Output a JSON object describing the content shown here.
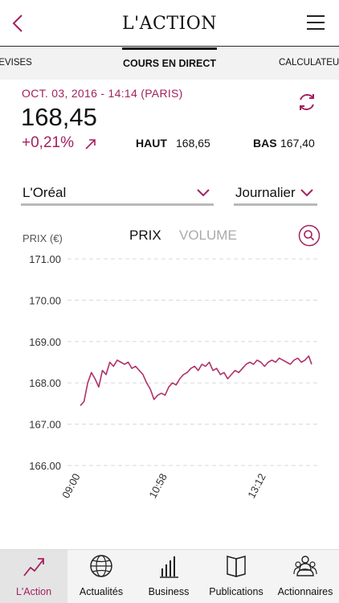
{
  "header": {
    "title": "L'ACTION"
  },
  "tabs": [
    {
      "label": "DEVISES"
    },
    {
      "label": "COURS EN DIRECT"
    },
    {
      "label": "CALCULATEUR"
    }
  ],
  "quote": {
    "date": "OCT. 03, 2016 - 14:14 (PARIS)",
    "price": "168,45",
    "change": "+0,21%",
    "high_label": "HAUT",
    "high_value": "168,65",
    "low_label": "BAS",
    "low_value": "167,40"
  },
  "selectors": {
    "company": "L'Oréal",
    "period": "Journalier"
  },
  "chart_controls": {
    "unit_label": "PRIX (€)",
    "tab_price": "PRIX",
    "tab_volume": "VOLUME"
  },
  "colors": {
    "accent": "#a3215f",
    "line": "#b0306a",
    "grid": "#d8d8d8"
  },
  "chart_data": {
    "type": "line",
    "title": "",
    "ylabel": "PRIX (€)",
    "ylim": [
      166.0,
      171.0
    ],
    "yticks": [
      "171.00",
      "170.00",
      "169.00",
      "168.00",
      "167.00",
      "166.00"
    ],
    "xticks": [
      "09:00",
      "10:58",
      "13:12"
    ],
    "grid": true,
    "series": [
      {
        "x": [
          "09:00",
          "09:05",
          "09:10",
          "09:15",
          "09:20",
          "09:25",
          "09:30",
          "09:35",
          "09:40",
          "09:45",
          "09:50",
          "09:55",
          "10:00",
          "10:05",
          "10:10",
          "10:15",
          "10:20",
          "10:25",
          "10:30",
          "10:35",
          "10:40",
          "10:45",
          "10:50",
          "10:55",
          "11:00",
          "11:05",
          "11:10",
          "11:15",
          "11:20",
          "11:25",
          "11:30",
          "11:35",
          "11:40",
          "11:45",
          "11:50",
          "11:55",
          "12:00",
          "12:05",
          "12:10",
          "12:15",
          "12:20",
          "12:25",
          "12:30",
          "12:35",
          "12:40",
          "12:45",
          "12:50",
          "12:55",
          "13:00",
          "13:05",
          "13:10",
          "13:15",
          "13:20",
          "13:25",
          "13:30",
          "13:35",
          "13:40",
          "13:45",
          "13:50",
          "13:55",
          "14:00",
          "14:05",
          "14:10",
          "14:14"
        ],
        "values": [
          167.45,
          167.55,
          168.0,
          168.25,
          168.1,
          167.9,
          168.3,
          168.2,
          168.5,
          168.4,
          168.55,
          168.5,
          168.45,
          168.5,
          168.35,
          168.4,
          168.3,
          168.2,
          168.0,
          167.85,
          167.6,
          167.7,
          167.75,
          167.7,
          167.9,
          168.0,
          167.95,
          168.1,
          168.2,
          168.25,
          168.35,
          168.4,
          168.3,
          168.45,
          168.4,
          168.5,
          168.3,
          168.35,
          168.2,
          168.25,
          168.1,
          168.2,
          168.3,
          168.25,
          168.35,
          168.45,
          168.5,
          168.45,
          168.55,
          168.5,
          168.4,
          168.5,
          168.55,
          168.5,
          168.6,
          168.55,
          168.5,
          168.45,
          168.55,
          168.6,
          168.5,
          168.55,
          168.65,
          168.45
        ]
      }
    ]
  },
  "bottom_nav": [
    {
      "label": "L'Action",
      "icon": "trend-chart-icon"
    },
    {
      "label": "Actualités",
      "icon": "globe-icon"
    },
    {
      "label": "Business",
      "icon": "bar-chart-icon"
    },
    {
      "label": "Publications",
      "icon": "book-icon"
    },
    {
      "label": "Actionnaires",
      "icon": "people-icon"
    }
  ]
}
